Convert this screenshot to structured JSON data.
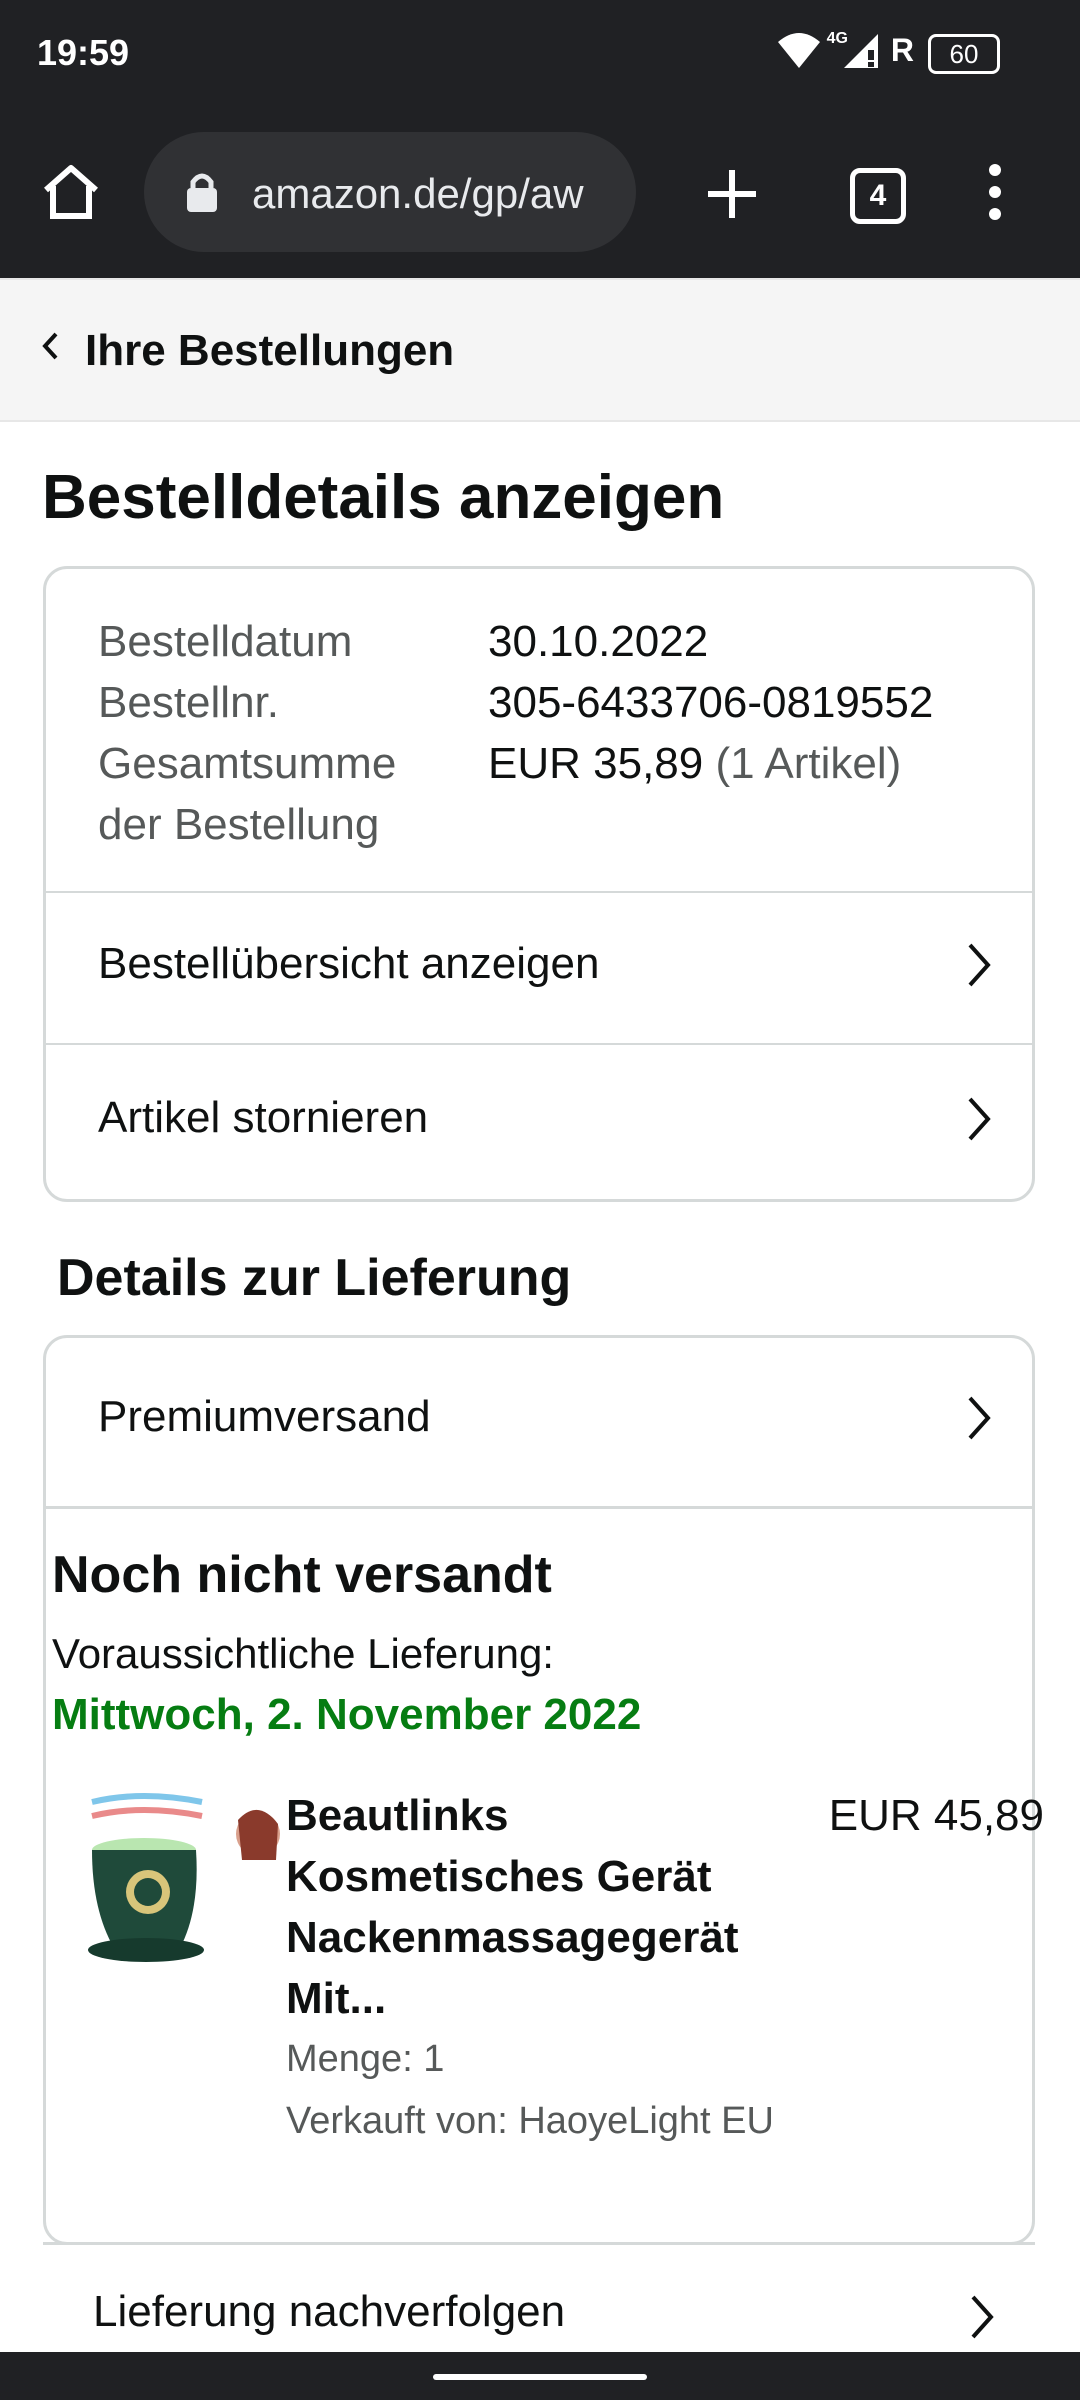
{
  "status_bar": {
    "time": "19:59",
    "network": "4G",
    "roaming": "R",
    "battery": "60"
  },
  "browser": {
    "url": "amazon.de/gp/aw",
    "tabs_count": "4"
  },
  "breadcrumb": {
    "label": "Ihre Bestellungen"
  },
  "page": {
    "title": "Bestelldetails anzeigen"
  },
  "order": {
    "date_label": "Bestelldatum",
    "date_value": "30.10.2022",
    "number_label": "Bestellnr.",
    "number_value": "305-6433706-0819552",
    "total_label_line1": "Gesamtsumme",
    "total_label_line2": "der Bestellung",
    "total_value": "EUR 35,89",
    "total_items": "(1 Artikel)",
    "actions": [
      {
        "label": "Bestellübersicht anzeigen"
      },
      {
        "label": "Artikel stornieren"
      }
    ]
  },
  "delivery": {
    "section_title": "Details zur Lieferung",
    "shipping_method": "Premiumversand",
    "status": "Noch nicht versandt",
    "expected_label": "Voraussichtliche Lieferung:",
    "expected_date": "Mittwoch, 2. November 2022",
    "track_label": "Lieferung nachverfolgen"
  },
  "product": {
    "title_lines": [
      "Beautlinks",
      "Kosmetisches Gerät",
      "Nackenmassagegerät",
      "Mit..."
    ],
    "price": "EUR 45,89",
    "quantity": "Menge: 1",
    "seller": "Verkauft von: HaoyeLight EU"
  },
  "colors": {
    "delivery_green": "#067d12",
    "border": "#d5d9d9",
    "chrome": "#202124"
  },
  "icons": [
    "wifi-icon",
    "signal-icon",
    "battery-icon",
    "home-icon",
    "lock-icon",
    "new-tab-icon",
    "tab-switcher-icon",
    "more-menu-icon",
    "chevron-left-icon",
    "chevron-right-icon"
  ]
}
